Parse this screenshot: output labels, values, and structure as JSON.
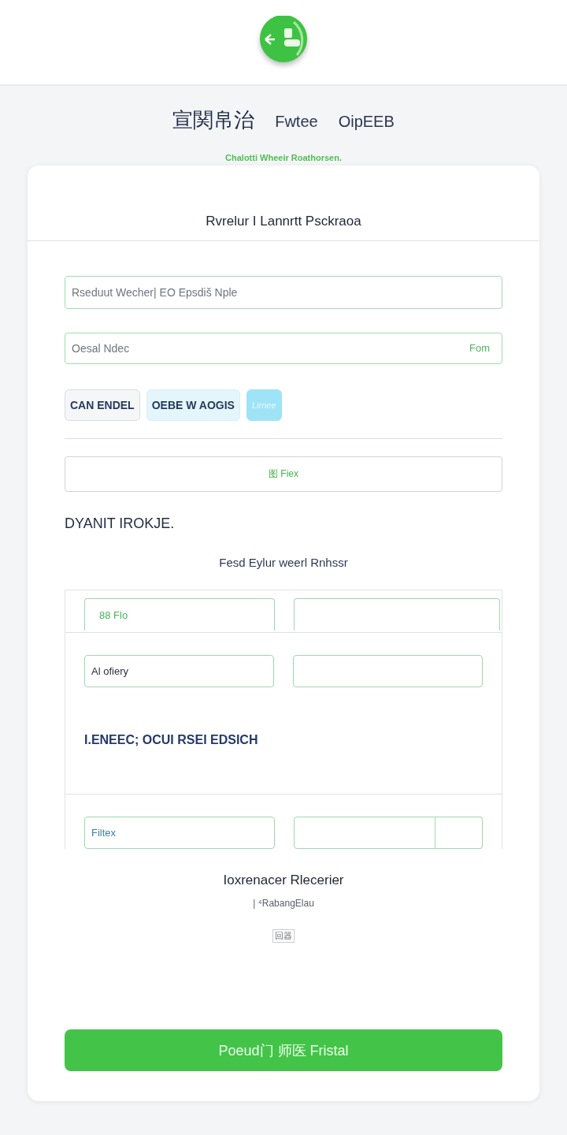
{
  "nav": {
    "tabs": [
      {
        "label": "宣関帛治",
        "selected": true
      },
      {
        "label": "Fwtee",
        "selected": false
      },
      {
        "label": "OipEEB",
        "selected": false
      }
    ],
    "subtitle": "Chalotti Wheeir Roathorsen."
  },
  "card": {
    "title": "Rvrelur I Lannrtt Psckraoa",
    "fields": [
      {
        "placeholder": "Rseduut Wecher| EO Epsdiš Nple"
      },
      {
        "placeholder": "Oesal Ndec",
        "suffix": "Fom"
      }
    ],
    "chips": [
      {
        "label": "CAN ENDEL",
        "selected": false
      },
      {
        "label": "OEBE W AOGIS",
        "selected": false
      },
      {
        "label": "Lirnee",
        "selected": true
      }
    ],
    "outline_button": "图 Fiex",
    "section_heading": "DYANIT IROKJE.",
    "section_caption": "Fesd Eylur weerl Rnhssr",
    "grid": {
      "rows": [
        [
          {
            "kind": "wide",
            "value": "88 Flo"
          },
          {
            "kind": "wide"
          }
        ],
        [
          {
            "kind": "wide",
            "value": "Al ofiery"
          },
          {
            "kind": "wide"
          }
        ]
      ],
      "label": "I.ENEEC; OCUI RSEI EDSICH",
      "last_row": [
        {
          "kind": "wide",
          "value": "Filtex"
        },
        {
          "kind": "wide"
        },
        {
          "kind": "narrow"
        }
      ]
    },
    "footer_title": "Ioxrenacer Rlecerier",
    "footer_sub": "| ⁴RabangElau",
    "footer_tag": "回器",
    "submit": "Poeud门 师医 Fristal"
  }
}
